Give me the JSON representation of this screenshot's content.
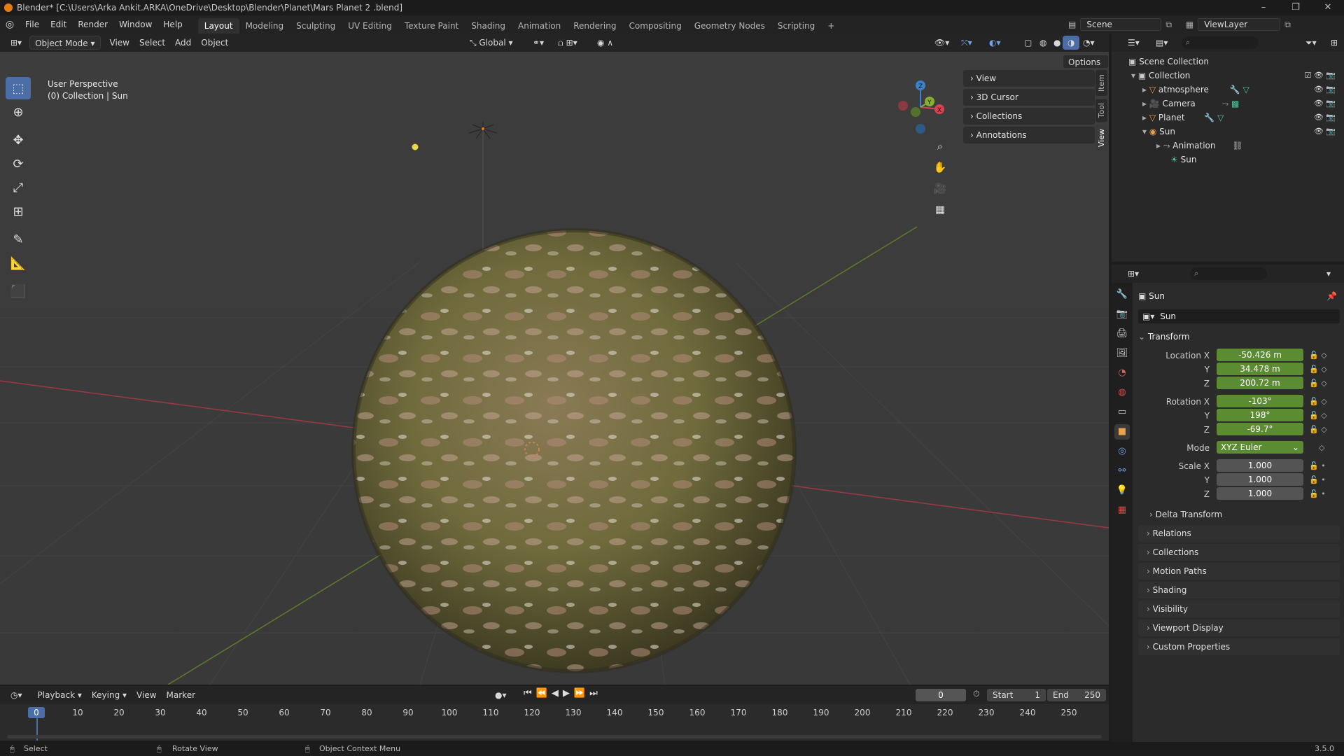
{
  "titlebar": {
    "title": "Blender* [C:\\Users\\Arka Ankit.ARKA\\OneDrive\\Desktop\\Blender\\Planet\\Mars Planet 2 .blend]",
    "minimize": "–",
    "maximize": "❐",
    "close": "✕"
  },
  "menu": {
    "items": [
      "File",
      "Edit",
      "Render",
      "Window",
      "Help"
    ]
  },
  "workspaces": {
    "tabs": [
      "Layout",
      "Modeling",
      "Sculpting",
      "UV Editing",
      "Texture Paint",
      "Shading",
      "Animation",
      "Rendering",
      "Compositing",
      "Geometry Nodes",
      "Scripting"
    ],
    "add": "+",
    "active": "Layout"
  },
  "scene": {
    "name": "Scene",
    "view_layer": "ViewLayer"
  },
  "viewport_header": {
    "mode": "Object Mode",
    "menus": [
      "View",
      "Select",
      "Add",
      "Object"
    ],
    "orientation": "Global",
    "options": "Options"
  },
  "viewport": {
    "perspective": "User Perspective",
    "context": "(0) Collection | Sun"
  },
  "gizmo": {
    "x": "X",
    "y": "Y",
    "z": "Z"
  },
  "npanel": {
    "sections": [
      "View",
      "3D Cursor",
      "Collections",
      "Annotations"
    ],
    "tabs": [
      "Item",
      "Tool",
      "View"
    ]
  },
  "outliner": {
    "root": "Scene Collection",
    "collection": "Collection",
    "items": [
      "atmosphere",
      "Camera",
      "Planet",
      "Sun"
    ],
    "sun_children": [
      "Animation",
      "Sun"
    ]
  },
  "properties": {
    "object_name": "Sun",
    "data_name": "Sun",
    "transform_header": "Transform",
    "location_label": "Location X",
    "rotation_label": "Rotation X",
    "scale_label": "Scale X",
    "mode_label": "Mode",
    "y": "Y",
    "z": "Z",
    "location": [
      "-50.426 m",
      "34.478 m",
      "200.72 m"
    ],
    "rotation": [
      "-103°",
      "198°",
      "-69.7°"
    ],
    "mode": "XYZ Euler",
    "scale": [
      "1.000",
      "1.000",
      "1.000"
    ],
    "delta": "Delta Transform",
    "sections": [
      "Relations",
      "Collections",
      "Motion Paths",
      "Shading",
      "Visibility",
      "Viewport Display",
      "Custom Properties"
    ]
  },
  "timeline": {
    "menus": [
      "Playback",
      "Keying",
      "View",
      "Marker"
    ],
    "current_frame": "0",
    "start_label": "Start",
    "start": "1",
    "end_label": "End",
    "end": "250",
    "ticks": [
      "0",
      "10",
      "20",
      "30",
      "40",
      "50",
      "60",
      "70",
      "80",
      "90",
      "100",
      "110",
      "120",
      "130",
      "140",
      "150",
      "160",
      "170",
      "180",
      "190",
      "200",
      "210",
      "220",
      "230",
      "240",
      "250"
    ]
  },
  "statusbar": {
    "select": "Select",
    "rotate": "Rotate View",
    "context": "Object Context Menu",
    "version": "3.5.0"
  },
  "colors": {
    "accent": "#4b6ea8",
    "field_green": "#5b8c31",
    "x_axis": "#d7434f",
    "y_axis": "#87b032",
    "z_axis": "#3d83cc",
    "blender_orange": "#e87d0d"
  }
}
